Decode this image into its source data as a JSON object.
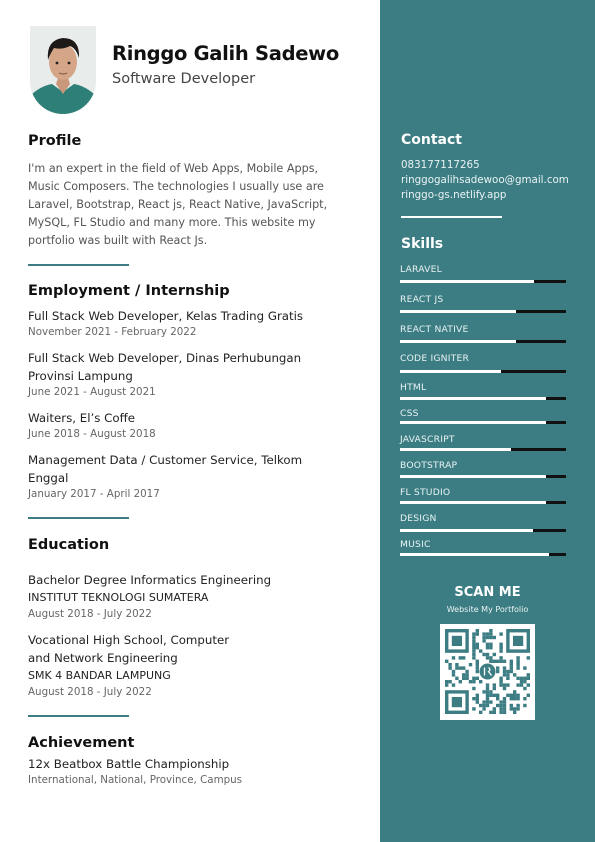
{
  "header": {
    "name": "Ringgo Galih Sadewo",
    "role": "Software Developer"
  },
  "profile": {
    "title": "Profile",
    "text": "I'm an expert in the field of Web Apps, Mobile Apps, Music Composers. The technologies I usually use are Laravel, Bootstrap, React js, React Native, JavaScript, MySQL, FL Studio and many more. This website my portfolio was built with React Js."
  },
  "employment": {
    "title": "Employment / Internship",
    "items": [
      {
        "role_lines": [
          "Full Stack Web Developer, Kelas Trading Gratis"
        ],
        "period": "November 2021 - February 2022"
      },
      {
        "role_lines": [
          "Full Stack Web Developer, Dinas Perhubungan",
          "Provinsi Lampung"
        ],
        "period": "June 2021 - August 2021"
      },
      {
        "role_lines": [
          "Waiters, El’s Coffe"
        ],
        "period": "June 2018 - August 2018"
      },
      {
        "role_lines": [
          "Management Data / Customer Service, Telkom",
          "Enggal"
        ],
        "period": "January 2017 - April 2017"
      }
    ]
  },
  "education": {
    "title": "Education",
    "items": [
      {
        "degree_lines": [
          "Bachelor Degree Informatics Engineering"
        ],
        "institution": "INSTITUT TEKNOLOGI SUMATERA",
        "period": "August 2018 - July 2022"
      },
      {
        "degree_lines": [
          "Vocational High School, Computer",
          "and Network Engineering"
        ],
        "institution": "SMK 4 BANDAR LAMPUNG",
        "period": "August 2018 - July 2022"
      }
    ]
  },
  "achievement": {
    "title": "Achievement",
    "item": "12x Beatbox Battle Championship",
    "detail": "International, National, Province, Campus"
  },
  "contact": {
    "title": "Contact",
    "phone": "083177117265",
    "email": "ringgogalihsadewoo@gmail.com",
    "website": "ringgo-gs.netlify.app"
  },
  "skills": {
    "title": "Skills",
    "items": [
      {
        "name": "LARAVEL",
        "level": 0.81
      },
      {
        "name": "REACT JS",
        "level": 0.7
      },
      {
        "name": "REACT NATIVE",
        "level": 0.7
      },
      {
        "name": "CODE IGNITER",
        "level": 0.61
      },
      {
        "name": "HTML",
        "level": 0.88
      },
      {
        "name": "CSS",
        "level": 0.88
      },
      {
        "name": "JAVASCRIPT",
        "level": 0.67
      },
      {
        "name": "BOOTSTRAP",
        "level": 0.88
      },
      {
        "name": "FL STUDIO",
        "level": 0.88
      },
      {
        "name": "DESIGN",
        "level": 0.8
      },
      {
        "name": "MUSIC",
        "level": 0.9
      }
    ]
  },
  "scan": {
    "title": "SCAN ME",
    "subtitle": "Website My Portfolio"
  },
  "colors": {
    "accent": "#3c7d83",
    "text": "#222222",
    "muted": "#666666"
  }
}
